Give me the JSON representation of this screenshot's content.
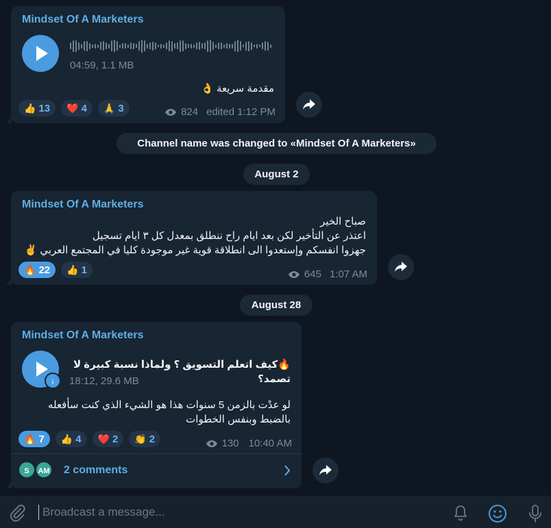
{
  "channel": {
    "name": "Mindset Of A Marketers"
  },
  "messages": [
    {
      "sender": "Mindset Of A Marketers",
      "audio_meta": "04:59, 1.1 MB",
      "text": "مقدمة سريعة 👌",
      "reactions": [
        {
          "emoji": "👍",
          "count": "13"
        },
        {
          "emoji": "❤️",
          "count": "4"
        },
        {
          "emoji": "🙏",
          "count": "3"
        }
      ],
      "views": "824",
      "time": "edited 1:12 PM"
    },
    {
      "sender": "Mindset Of A Marketers",
      "lines": [
        "صباح الخير",
        "اعتذر عن التأخير لكن بعد ايام راح ننطلق بمعدل كل ٣ ايام تسجيل",
        "جهزوا انفسكم وإستعدوا الى انطلاقة قوية غير موجودة كليا في المجتمع العربي ✌️"
      ],
      "reactions": [
        {
          "emoji": "🔥",
          "count": "22",
          "active": true
        },
        {
          "emoji": "👍",
          "count": "1"
        }
      ],
      "views": "645",
      "time": "1:07 AM"
    },
    {
      "sender": "Mindset Of A Marketers",
      "audio_title": "🔥كيف اتعلم التسويق ؟ ولماذا نسبة كبيرة لا تصمد؟",
      "audio_meta": "18:12, 29.6 MB",
      "text": "لو عدْت بالزمن 5 سنوات هذا هو الشيء الذي كنت سأفعله بالضبط وبنفس الخطوات",
      "reactions": [
        {
          "emoji": "🔥",
          "count": "7",
          "active": true
        },
        {
          "emoji": "👍",
          "count": "4"
        },
        {
          "emoji": "❤️",
          "count": "2"
        },
        {
          "emoji": "👏",
          "count": "2"
        }
      ],
      "views": "130",
      "time": "10:40 AM",
      "comments": {
        "label": "2 comments",
        "avatars": [
          {
            "initials": "S",
            "color": "#3aa596"
          },
          {
            "initials": "AM",
            "color": "#3aa596"
          }
        ]
      }
    }
  ],
  "service": {
    "rename": "Channel name was changed to «Mindset Of A Marketers»"
  },
  "dates": {
    "d1": "August 2",
    "d2": "August 28"
  },
  "composer": {
    "placeholder": "Broadcast a message...",
    "icons": [
      "paperclip-icon",
      "bell-icon",
      "emoji-icon",
      "microphone-icon"
    ]
  },
  "colors": {
    "accent": "#4a9be0",
    "background": "#0e1621",
    "bubble": "#182533",
    "name": "#5eaee6"
  }
}
